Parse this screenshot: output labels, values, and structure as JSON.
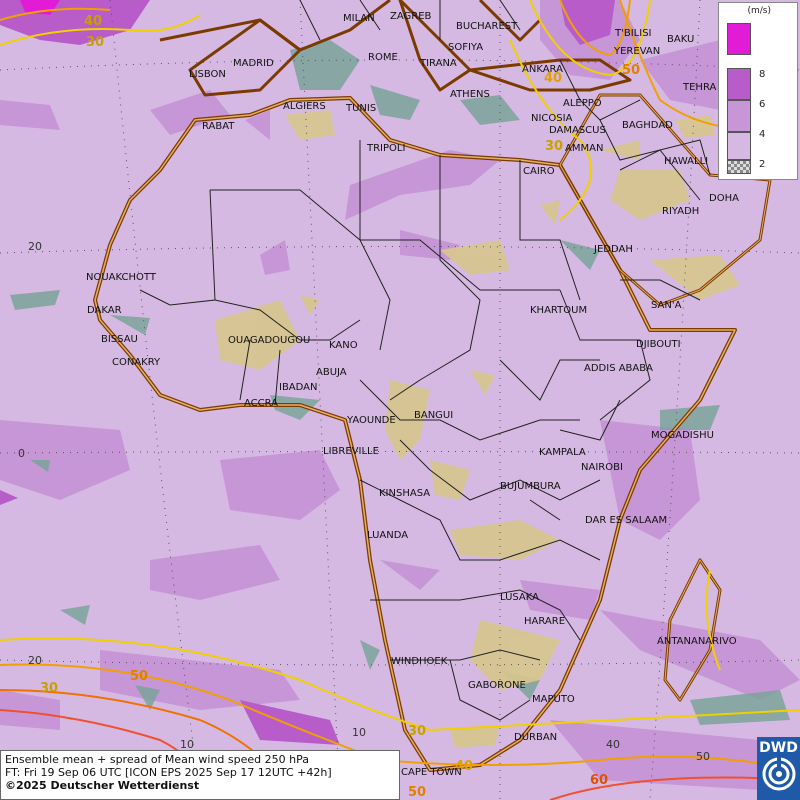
{
  "map": {
    "cities": [
      {
        "name": "MILAN"
      },
      {
        "name": "ZAGREB"
      },
      {
        "name": "BUCHAREST"
      },
      {
        "name": "T'BILISI"
      },
      {
        "name": "BAKU"
      },
      {
        "name": "MADRID"
      },
      {
        "name": "ROME"
      },
      {
        "name": "SOFIYA"
      },
      {
        "name": "YEREVAN"
      },
      {
        "name": "LISBON"
      },
      {
        "name": "TIRANA"
      },
      {
        "name": "ANKARA"
      },
      {
        "name": "TEHRA"
      },
      {
        "name": "ALGIERS"
      },
      {
        "name": "TUNIS"
      },
      {
        "name": "ATHENS"
      },
      {
        "name": "ALEPPO"
      },
      {
        "name": "RABAT"
      },
      {
        "name": "NICOSIA"
      },
      {
        "name": "BAGHDAD"
      },
      {
        "name": "DAMASCUS"
      },
      {
        "name": "TRIPOLI"
      },
      {
        "name": "AMMAN"
      },
      {
        "name": "HAWALLI"
      },
      {
        "name": "CAIRO"
      },
      {
        "name": "DOHA"
      },
      {
        "name": "RIYADH"
      },
      {
        "name": "JEDDAH"
      },
      {
        "name": "NOUAKCHOTT"
      },
      {
        "name": "SAN'A"
      },
      {
        "name": "DAKAR"
      },
      {
        "name": "KHARTOUM"
      },
      {
        "name": "BISSAU"
      },
      {
        "name": "OUAGADOUGOU"
      },
      {
        "name": "KANO"
      },
      {
        "name": "DJIBOUTI"
      },
      {
        "name": "CONAKRY"
      },
      {
        "name": "ABUJA"
      },
      {
        "name": "ADDIS ABABA"
      },
      {
        "name": "IBADAN"
      },
      {
        "name": "ACCRA"
      },
      {
        "name": "YAOUNDE"
      },
      {
        "name": "BANGUI"
      },
      {
        "name": "MOGADISHU"
      },
      {
        "name": "LIBREVILLE"
      },
      {
        "name": "KAMPALA"
      },
      {
        "name": "NAIROBI"
      },
      {
        "name": "KINSHASA"
      },
      {
        "name": "BUJUMBURA"
      },
      {
        "name": "DAR ES SALAAM"
      },
      {
        "name": "LUANDA"
      },
      {
        "name": "LUSAKA"
      },
      {
        "name": "HARARE"
      },
      {
        "name": "ANTANANARIVO"
      },
      {
        "name": "WINDHOEK"
      },
      {
        "name": "GABORONE"
      },
      {
        "name": "MAPUTO"
      },
      {
        "name": "DURBAN"
      },
      {
        "name": "CAPE TOWN"
      }
    ],
    "grid_labels": [
      "20",
      "0",
      "20",
      "10",
      "10",
      "40",
      "50"
    ],
    "contour_labels": [
      {
        "text": "40",
        "color": "#c8a000"
      },
      {
        "text": "30",
        "color": "#c8a000"
      },
      {
        "text": "40",
        "color": "#e0a000"
      },
      {
        "text": "50",
        "color": "#e08000"
      },
      {
        "text": "30",
        "color": "#c8a000"
      },
      {
        "text": "30",
        "color": "#c8a000"
      },
      {
        "text": "50",
        "color": "#e08000"
      },
      {
        "text": "30",
        "color": "#c8a000"
      },
      {
        "text": "40",
        "color": "#e0a000"
      },
      {
        "text": "50",
        "color": "#e08000"
      },
      {
        "text": "60",
        "color": "#e05000"
      }
    ]
  },
  "legend": {
    "unit": "(m/s)",
    "levels": [
      {
        "label": "8",
        "color": "#e21bd6"
      },
      {
        "label": "6",
        "color": "#b85cc9"
      },
      {
        "label": "4",
        "color": "#c796d6"
      },
      {
        "label": "2",
        "color": "#d6b9e3"
      }
    ],
    "lowest_fill": "#d6b9e3"
  },
  "footer": {
    "line1": "Ensemble mean + spread of Mean wind speed 250 hPa",
    "line2": "FT: Fri 19 Sep 06 UTC [ICON EPS 2025 Sep 17 12UTC +42h]",
    "line3": "©2025 Deutscher Wetterdienst"
  },
  "logo": {
    "text": "DWD"
  }
}
